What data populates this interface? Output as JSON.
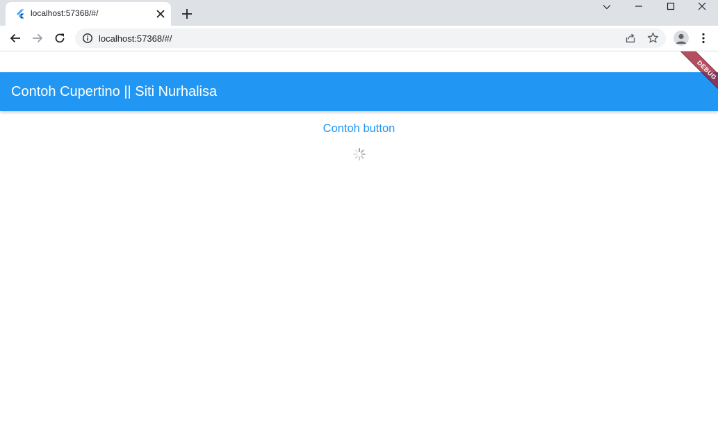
{
  "browser": {
    "tab_title": "localhost:57368/#/",
    "url": "localhost:57368/#/",
    "icons": {
      "tab": "flutter-icon",
      "close": "close-icon",
      "new_tab": "plus-icon",
      "back": "back-arrow-icon",
      "forward": "forward-arrow-icon",
      "reload": "reload-icon",
      "site_info": "info-icon",
      "share": "share-icon",
      "bookmark": "star-icon",
      "profile": "avatar-icon",
      "menu": "kebab-menu-icon",
      "tab_search": "chevron-down-icon",
      "minimize": "minimize-icon",
      "maximize": "maximize-icon",
      "window_close": "close-icon"
    }
  },
  "app": {
    "title": "Contoh Cupertino || Siti Nurhalisa",
    "button_label": "Contoh button",
    "debug_banner": "DEBUG",
    "colors": {
      "primary": "#2196f3",
      "appbar_text": "#ffffff",
      "banner": "#a01e32"
    }
  }
}
